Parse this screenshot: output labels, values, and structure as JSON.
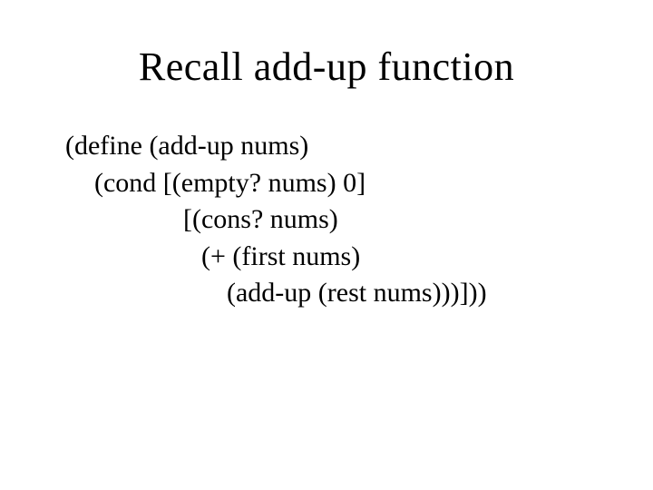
{
  "title": "Recall add-up function",
  "code": {
    "line1": "(define (add-up nums)",
    "line2": "(cond [(empty? nums) 0]",
    "line3": "[(cons? nums)",
    "line4": "(+ (first nums)",
    "line5": "(add-up (rest nums)))]))"
  }
}
